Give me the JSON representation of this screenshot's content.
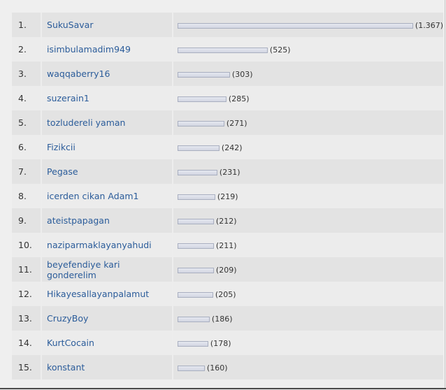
{
  "colors": {
    "link": "#2b5c9a",
    "row_odd": "#e3e3e3",
    "row_even": "#ececec",
    "bar_border": "#a9afc0"
  },
  "leaderboard": {
    "max_value": 1367,
    "rows": [
      {
        "rank": "1.",
        "name": "SukuSavar",
        "value": 1367,
        "count_label": "(1.367)"
      },
      {
        "rank": "2.",
        "name": "isimbulamadim949",
        "value": 525,
        "count_label": "(525)"
      },
      {
        "rank": "3.",
        "name": "waqqaberry16",
        "value": 303,
        "count_label": "(303)"
      },
      {
        "rank": "4.",
        "name": "suzerain1",
        "value": 285,
        "count_label": "(285)"
      },
      {
        "rank": "5.",
        "name": "tozludereli yaman",
        "value": 271,
        "count_label": "(271)"
      },
      {
        "rank": "6.",
        "name": "Fizikcii",
        "value": 242,
        "count_label": "(242)"
      },
      {
        "rank": "7.",
        "name": "Pegase",
        "value": 231,
        "count_label": "(231)"
      },
      {
        "rank": "8.",
        "name": "icerden cikan Adam1",
        "value": 219,
        "count_label": "(219)"
      },
      {
        "rank": "9.",
        "name": "ateistpapagan",
        "value": 212,
        "count_label": "(212)"
      },
      {
        "rank": "10.",
        "name": "naziparmaklayanyahudi",
        "value": 211,
        "count_label": "(211)"
      },
      {
        "rank": "11.",
        "name": "beyefendiye kari gonderelim",
        "value": 209,
        "count_label": "(209)"
      },
      {
        "rank": "12.",
        "name": "Hikayesallayanpalamut",
        "value": 205,
        "count_label": "(205)"
      },
      {
        "rank": "13.",
        "name": "CruzyBoy",
        "value": 186,
        "count_label": "(186)"
      },
      {
        "rank": "14.",
        "name": "KurtCocain",
        "value": 178,
        "count_label": "(178)"
      },
      {
        "rank": "15.",
        "name": "konstant",
        "value": 160,
        "count_label": "(160)"
      }
    ]
  }
}
